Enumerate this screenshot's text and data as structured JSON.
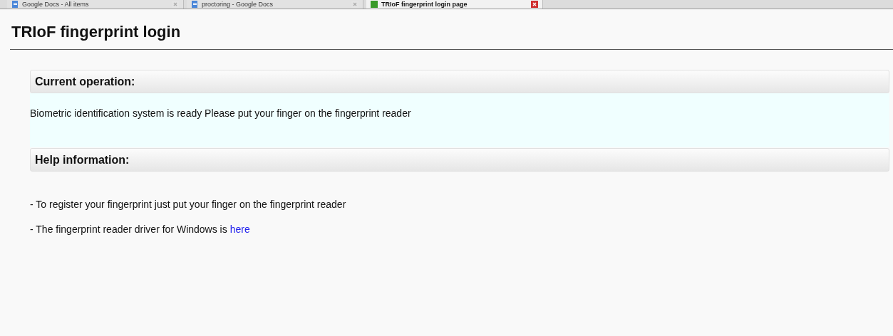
{
  "browser_tabs": [
    {
      "title": "Google Docs - All items",
      "selected": false,
      "kind": "docs"
    },
    {
      "title": "proctoring - Google Docs",
      "selected": false,
      "kind": "docs"
    },
    {
      "title": "TRIoF fingerprint login page",
      "selected": true,
      "kind": "site"
    }
  ],
  "page": {
    "title": "TRIoF fingerprint login"
  },
  "current_operation": {
    "heading": "Current operation:",
    "message": "Biometric identification system is ready Please put your finger on the fingerprint reader"
  },
  "help": {
    "heading": "Help information:",
    "lines": [
      {
        "text": "- To register your fingerprint just put your finger on the fingerprint reader"
      },
      {
        "text": "- The fingerprint reader driver for Windows is",
        "link": "here"
      }
    ]
  }
}
